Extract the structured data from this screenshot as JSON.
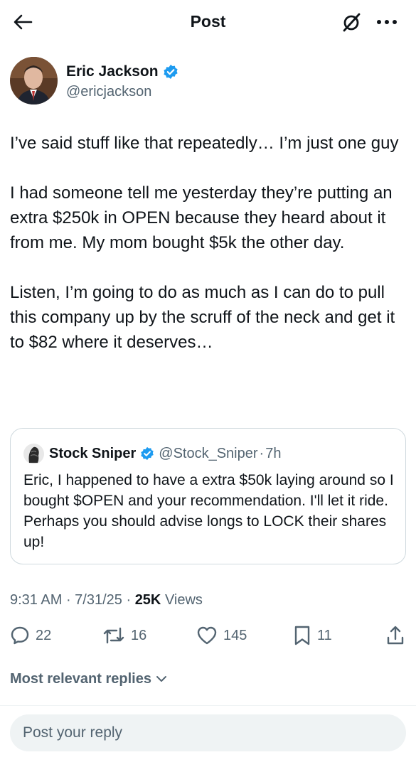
{
  "colors": {
    "text": "#0f1419",
    "muted": "#536471",
    "verified": "#1d9bf0",
    "border": "#cfd9de"
  },
  "header": {
    "title": "Post",
    "back_icon": "arrow-left-icon",
    "grok_icon": "grok-icon",
    "more_icon": "more-icon"
  },
  "author": {
    "name": "Eric Jackson",
    "handle": "@ericjackson",
    "verified": true
  },
  "tweet": {
    "paragraphs": [
      "I’ve said stuff like that repeatedly… I’m just one guy",
      "I had someone tell me yesterday they’re putting an extra $250k in OPEN because they heard about it from me. My mom bought $5k the other day.",
      "Listen, I’m going to do as much as I can do to pull this company up by the scruff of the neck and get it to $82 where it deserves…"
    ]
  },
  "quote": {
    "name": "Stock Sniper",
    "handle": "@Stock_Sniper",
    "separator": "·",
    "time": "7h",
    "text": "Eric, I happened to have a extra $50k laying around so I bought $OPEN and your recommendation.  I'll let it ride.  Perhaps you should advise longs to LOCK their shares up!"
  },
  "meta": {
    "time": "9:31 AM",
    "sep1": " · ",
    "date": "7/31/25",
    "sep2": " · ",
    "views_count": "25K",
    "views_label": " Views"
  },
  "actions": {
    "replies": "22",
    "reposts": "16",
    "likes": "145",
    "bookmarks": "11"
  },
  "replies_sort": {
    "label": "Most relevant replies"
  },
  "reply_box": {
    "placeholder": "Post your reply"
  }
}
